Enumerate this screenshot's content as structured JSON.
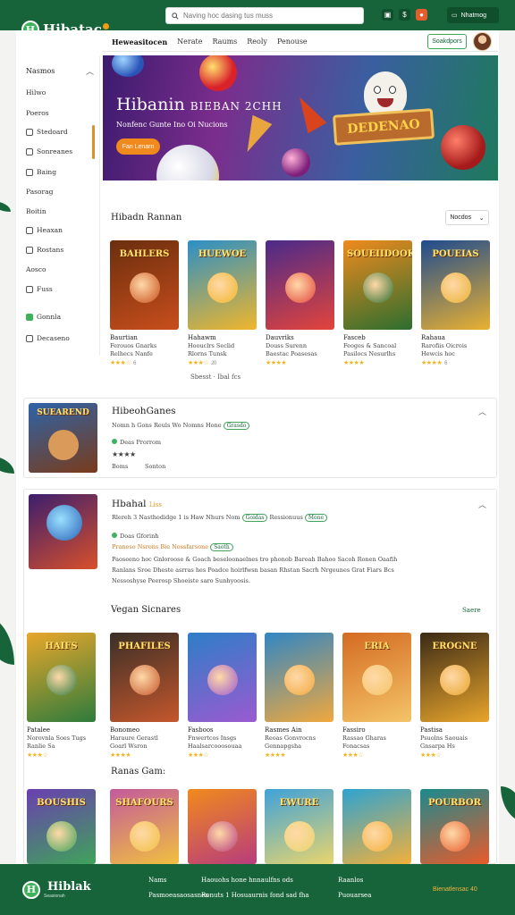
{
  "header": {
    "logo_text": "Hibatac",
    "search_placeholder": "Naving hoc dasing tus muss",
    "account_label": "Nhatmog",
    "icons": [
      "gift-icon",
      "coin-icon",
      "bell-icon",
      "message-icon"
    ]
  },
  "nav": {
    "items": [
      "Heweasitocen",
      "Nerate",
      "Raums",
      "Reoly",
      "Penouse"
    ],
    "button_label": "Soakdpors"
  },
  "sidebar": {
    "heading": "Nasmos",
    "items": [
      {
        "label": "Hilwo",
        "icon": "none"
      },
      {
        "label": "Poeros",
        "icon": "none"
      },
      {
        "label": "Stedoard",
        "icon": "clock-icon"
      },
      {
        "label": "Sonreanes",
        "icon": "grid-icon"
      },
      {
        "label": "Baing",
        "icon": "tag-icon"
      },
      {
        "label": "Pasorag",
        "icon": "none"
      },
      {
        "label": "Boitin",
        "icon": "none"
      },
      {
        "label": "Heaxan",
        "icon": "book-icon"
      },
      {
        "label": "Rostans",
        "icon": "chart-icon"
      },
      {
        "label": "Aosco",
        "icon": "none"
      },
      {
        "label": "Fuss",
        "icon": "box-icon"
      },
      {
        "label": "Gonnla",
        "icon": "green-square-icon"
      },
      {
        "label": "Decaseno",
        "icon": "settings-icon"
      }
    ]
  },
  "hero": {
    "title": "Hibanin",
    "title_small": "BIEBAN 2CHH",
    "subtitle": "Nonfenc Gunte Ino Oi Nucions",
    "button_label": "Fan Lenarn",
    "sign_text": "DEDENAO"
  },
  "featured": {
    "title": "Hibadn Rannan",
    "sort_label": "Nocdos",
    "pager": "Sbesst  ·  Ibal  fcs",
    "cards": [
      {
        "thumb_text": "BAHLERS",
        "name": "Baurtian",
        "sub1": "Ferouos Gnarks",
        "sub2": "Relhecs Nanfe",
        "rating": "★★★☆",
        "count": "6",
        "colors": [
          "#6b2e0e",
          "#c84e1c"
        ]
      },
      {
        "thumb_text": "HUEWOE",
        "name": "Hahawm",
        "sub1": "Hoouclrs Seclid",
        "sub2": "Rlorns Tunsk",
        "rating": "★★★☆",
        "count": "20",
        "colors": [
          "#2b8fc7",
          "#f0b62b"
        ]
      },
      {
        "thumb_text": "",
        "name": "Dauvriks",
        "sub1": "Douss Surenn",
        "sub2": "Baestac Poasesas",
        "rating": "★★★★",
        "count": "",
        "colors": [
          "#4a2a8a",
          "#e3443b"
        ]
      },
      {
        "thumb_text": "SOUEIIDOOK",
        "name": "Fasceb",
        "sub1": "Feoges & Sancoal",
        "sub2": "Pasilocs Nesurlhs",
        "rating": "★★★★",
        "count": "",
        "colors": [
          "#f08a1d",
          "#2c6e2f"
        ]
      },
      {
        "thumb_text": "POUEIAS",
        "name": "Rahaua",
        "sub1": "Rarofiis Oicrois",
        "sub2": "Hewcis hoc",
        "rating": "★★★★",
        "count": "6",
        "colors": [
          "#1e4b8f",
          "#e9b132"
        ]
      }
    ]
  },
  "row1": {
    "thumb_text": "SUEAREND",
    "title": "HibeohGanes",
    "meta": "Nomn h  Gons Reuls  Wo  Nomns  Hone",
    "pill": "Grasdo",
    "owner": "Deas Prorrom",
    "rating": "★★★★",
    "count": "",
    "foot_left": "Boms",
    "foot_right": "Sonton"
  },
  "row2": {
    "thumb_text": "",
    "title": "Hbahal",
    "badge": "Liss",
    "meta": "Rlereh 3 Nasthodidge 1 is Haw Nhurs Nom",
    "pill": "Goidas",
    "meta2": "Ressionuus",
    "pill2": "Mone",
    "owner": "Doas Gforinh",
    "tags": "Praneso Nsrons Bie Nossfarsone",
    "tag_pill": "Saoth",
    "desc1": "Paoseeno hoc Gnloroose & Goach beseloonaelnes tro phonob Baroah Bahoo Sacoh Ronen Oaafih",
    "desc2": "Ranlans Sroe Dheste asrras hes Poadce hoirlfwsn basan Rhstan Sacrh Nrgeunes Grat Fiars Bcs",
    "desc3": "Nessoshyse Peerosp Shoeiste saro Sunhyoosis."
  },
  "vegan": {
    "title": "Vegan Sicnares",
    "link": "Saere",
    "cards": [
      {
        "thumb_text": "HAIFS",
        "name": "Patalee",
        "sub1": "Norovnla Soes Tugs",
        "sub2": "Ranlie Sa",
        "rating": "★★★☆",
        "colors": [
          "#e8a72b",
          "#2e7b3c"
        ]
      },
      {
        "thumb_text": "PHAFILES",
        "name": "Bonomeo",
        "sub1": "Haraure Gerastl",
        "sub2": "Goarl Wsron",
        "rating": "★★★★",
        "colors": [
          "#3a2f28",
          "#c4572c"
        ]
      },
      {
        "thumb_text": "",
        "name": "Fasboos",
        "sub1": "Fnwertcos Insgs",
        "sub2": "Haalsarcooosouaa",
        "rating": "★★★☆",
        "colors": [
          "#2e7ec7",
          "#9a5ad0"
        ]
      },
      {
        "thumb_text": "",
        "name": "Rasmes Ain",
        "sub1": "Reoas Gonvrocns",
        "sub2": "Gennapgsha",
        "rating": "★★★★",
        "colors": [
          "#3186c4",
          "#f0a83e"
        ]
      },
      {
        "thumb_text": "ERIA",
        "name": "Fassiro",
        "sub1": "Rassao Gharas",
        "sub2": "Fonacsas",
        "rating": "★★★☆",
        "colors": [
          "#d46b22",
          "#f4c468"
        ]
      },
      {
        "thumb_text": "EROGNE",
        "name": "Pastisa",
        "sub1": "Psuolns Saouais",
        "sub2": "Gnsarpa Hs",
        "rating": "★★★☆",
        "colors": [
          "#3b2a16",
          "#e8a52c"
        ]
      }
    ]
  },
  "more": {
    "title": "Ranas Gam:",
    "thumbs": [
      {
        "text": "BOUSHIS",
        "colors": [
          "#6a3fb0",
          "#3fa35a"
        ]
      },
      {
        "text": "SHAFOURS",
        "colors": [
          "#c35a9b",
          "#f0c040"
        ]
      },
      {
        "text": "",
        "colors": [
          "#f08a1d",
          "#b83c7c"
        ]
      },
      {
        "text": "EWURE",
        "colors": [
          "#3fa2d9",
          "#e8d56e"
        ]
      },
      {
        "text": "",
        "colors": [
          "#2ea3d2",
          "#f2b03a"
        ]
      },
      {
        "text": "POURBOR",
        "colors": [
          "#1a8a8f",
          "#e85b2b"
        ]
      }
    ]
  },
  "footer": {
    "logo_text": "Hiblak",
    "logo_sub": "Seasionah",
    "col1": [
      "Nams",
      "Pasmoeasaosasnes"
    ],
    "col2": [
      "Haouohs hone hnnaulfns ods",
      "Ronuts  1  Hosuaurnis fond sad fha"
    ],
    "col3": [
      "Raanlos",
      "Puouarsea"
    ],
    "right": "Bienatlensac 40"
  },
  "colors": {
    "brand_green": "#17643a",
    "accent_orange": "#f08a1d",
    "star_gold": "#f1b524"
  }
}
